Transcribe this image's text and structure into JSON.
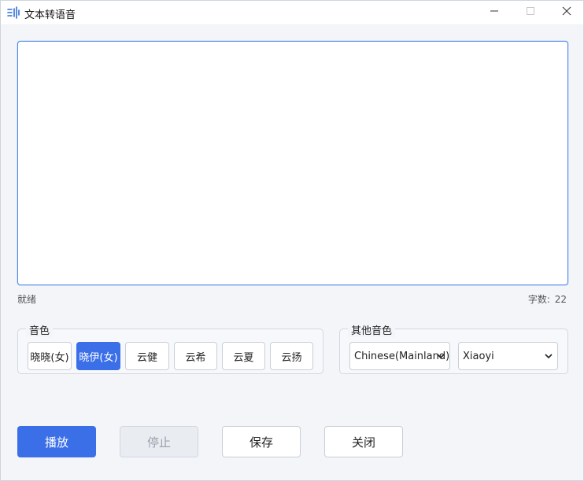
{
  "window": {
    "title": "文本转语音",
    "icons": {
      "app": "tts-app-icon",
      "minimize": "minimize-icon",
      "maximize": "maximize-icon",
      "close": "close-icon"
    }
  },
  "editor": {
    "value": "",
    "placeholder": ""
  },
  "status": {
    "text": "就绪",
    "count_label": "字数:",
    "count_value": "22"
  },
  "voice_group": {
    "legend": "音色",
    "selected": "晓伊(女)",
    "voices": [
      "晓晓(女)",
      "晓伊(女)",
      "云健",
      "云希",
      "云夏",
      "云扬"
    ]
  },
  "other_group": {
    "legend": "其他音色",
    "language_selected": "Chinese(Mainland)",
    "voice_selected": "Xiaoyi"
  },
  "actions": {
    "play": "播放",
    "stop": "停止",
    "save": "保存",
    "close": "关闭"
  },
  "colors": {
    "accent": "#3a6fe8",
    "border": "#c9ced6",
    "background": "#f3f5f9"
  }
}
